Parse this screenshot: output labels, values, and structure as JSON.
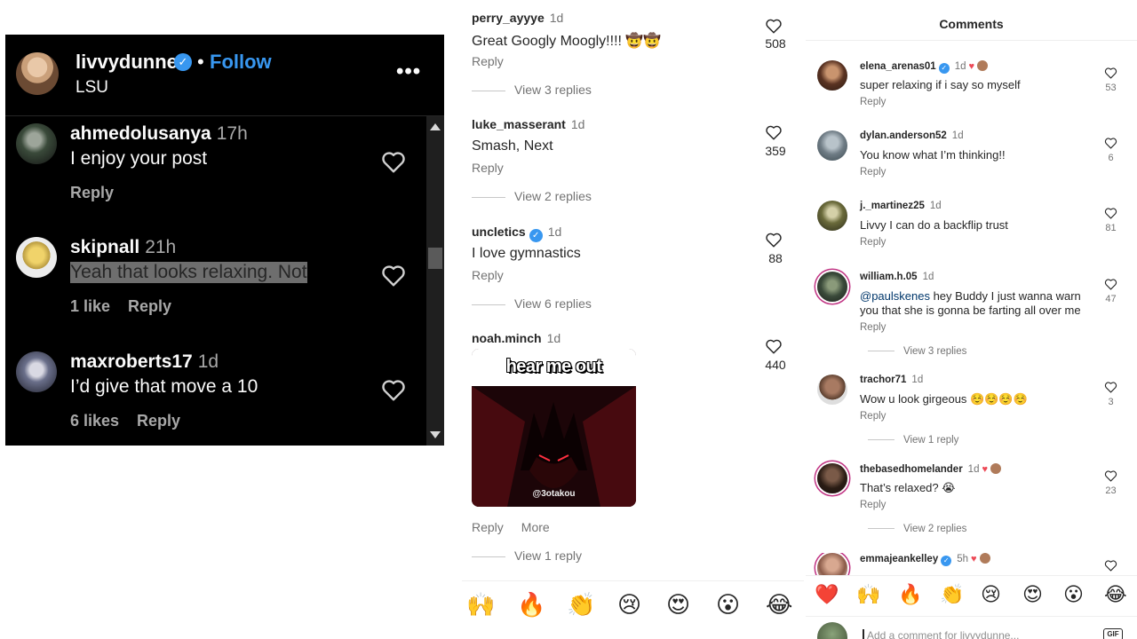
{
  "left_panel": {
    "header": {
      "username": "livvydunne",
      "dot": "•",
      "follow": "Follow",
      "subtitle": "LSU",
      "more": "•••"
    },
    "comments": [
      {
        "user": "ahmedolusanya",
        "time": "17h",
        "text": "I enjoy your post",
        "likes": "",
        "reply": "Reply"
      },
      {
        "user": "skipnall",
        "time": "21h",
        "text": "Yeah that looks relaxing. Not",
        "likes": "1 like",
        "reply": "Reply",
        "highlighted": true
      },
      {
        "user": "maxroberts17",
        "time": "1d",
        "text": "I’d give that move a 10",
        "likes": "6 likes",
        "reply": "Reply"
      }
    ]
  },
  "middle_panel": {
    "comments": [
      {
        "user": "perry_ayyye",
        "time": "1d",
        "text": "Great Googly Moogly!!!! 🤠🤠",
        "reply": "Reply",
        "views": "View 3 replies",
        "count": "508"
      },
      {
        "user": "luke_masserant",
        "time": "1d",
        "text": "Smash, Next",
        "reply": "Reply",
        "views": "View 2 replies",
        "count": "359"
      },
      {
        "user": "uncletics",
        "time": "1d",
        "text": "I love gymnastics",
        "reply": "Reply",
        "views": "View 6 replies",
        "count": "88",
        "verified": true
      },
      {
        "user": "noah.minch",
        "time": "1d",
        "gif_caption": "hear me out",
        "gif_watermark": "@3otakou",
        "reply": "Reply",
        "more": "More",
        "views": "View 1 reply",
        "count": "440"
      }
    ],
    "emoji_bar": [
      "🙌",
      "🔥",
      "👏",
      "😢",
      "😍",
      "😮",
      "😂"
    ]
  },
  "right_panel": {
    "title": "Comments",
    "comments": [
      {
        "user": "elena_arenas01",
        "time": "1d",
        "text": "super relaxing if i say so myself",
        "reply": "Reply",
        "views": "",
        "count": "53",
        "verified": true,
        "creator_liked": true
      },
      {
        "user": "dylan.anderson52",
        "time": "1d",
        "text": "You know what I’m thinking!!",
        "reply": "Reply",
        "views": "",
        "count": "6"
      },
      {
        "user": "j._martinez25",
        "time": "1d",
        "text": "Livvy I can do a backflip trust",
        "reply": "Reply",
        "views": "",
        "count": "81"
      },
      {
        "user": "william.h.05",
        "time": "1d",
        "mention": "@paulskenes",
        "text": " hey Buddy I just wanna warn you that she is gonna be farting all over me",
        "reply": "Reply",
        "views": "View 3 replies",
        "count": "47"
      },
      {
        "user": "trachor71",
        "time": "1d",
        "text": "Wow u look girgeous ☺️☺️☺️☺️",
        "reply": "Reply",
        "views": "View 1 reply",
        "count": "3"
      },
      {
        "user": "thebasedhomelander",
        "time": "1d",
        "text": "That’s relaxed? 😭",
        "reply": "Reply",
        "views": "View 2 replies",
        "count": "23",
        "creator_liked": true
      },
      {
        "user": "emmajeankelley",
        "time": "5h",
        "text": "",
        "reply": "",
        "views": "",
        "count": "",
        "verified": true,
        "creator_liked": true
      }
    ],
    "emoji_bar": [
      "❤️",
      "🙌",
      "🔥",
      "👏",
      "😢",
      "😍",
      "😮",
      "😂"
    ],
    "add_comment_placeholder": "Add a comment for livvydunne...",
    "gif_label": "GIF"
  },
  "colors": {
    "accent": "#3897f0",
    "like": "#ed4956",
    "muted": "#737373"
  }
}
